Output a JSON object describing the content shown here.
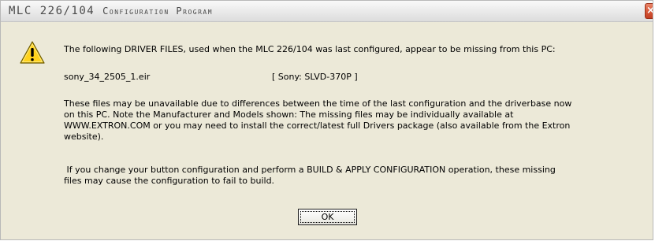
{
  "window": {
    "title_main": "MLC 226/104 ",
    "title_smallcaps": "Configuration Program",
    "close_glyph": "×"
  },
  "icon": "warning-triangle",
  "message": {
    "intro": "The following DRIVER FILES, used when the MLC 226/104 was last configured, appear to be missing from this PC:",
    "missing_file": "sony_34_2505_1.eir",
    "missing_model": "[ Sony: SLVD-370P ]",
    "paragraph2_lines": [
      "These files may be unavailable due to differences between  the time of the last configuration and the driverbase now",
      "on this PC. Note the Manufacturer and Models shown: The missing files may be individually available at",
      "WWW.EXTRON.COM or you may need to install the correct/latest full Drivers package (also available from the Extron",
      "website)."
    ],
    "paragraph3_lines": [
      " If you change your button configuration and perform a BUILD & APPLY CONFIGURATION operation, these missing",
      "files may cause the configuration to fail to build."
    ]
  },
  "buttons": {
    "ok_label": "OK"
  },
  "colors": {
    "dialog_bg": "#ece9d8",
    "icon_yellow": "#ffd21c",
    "close_red": "#d85a3b"
  }
}
